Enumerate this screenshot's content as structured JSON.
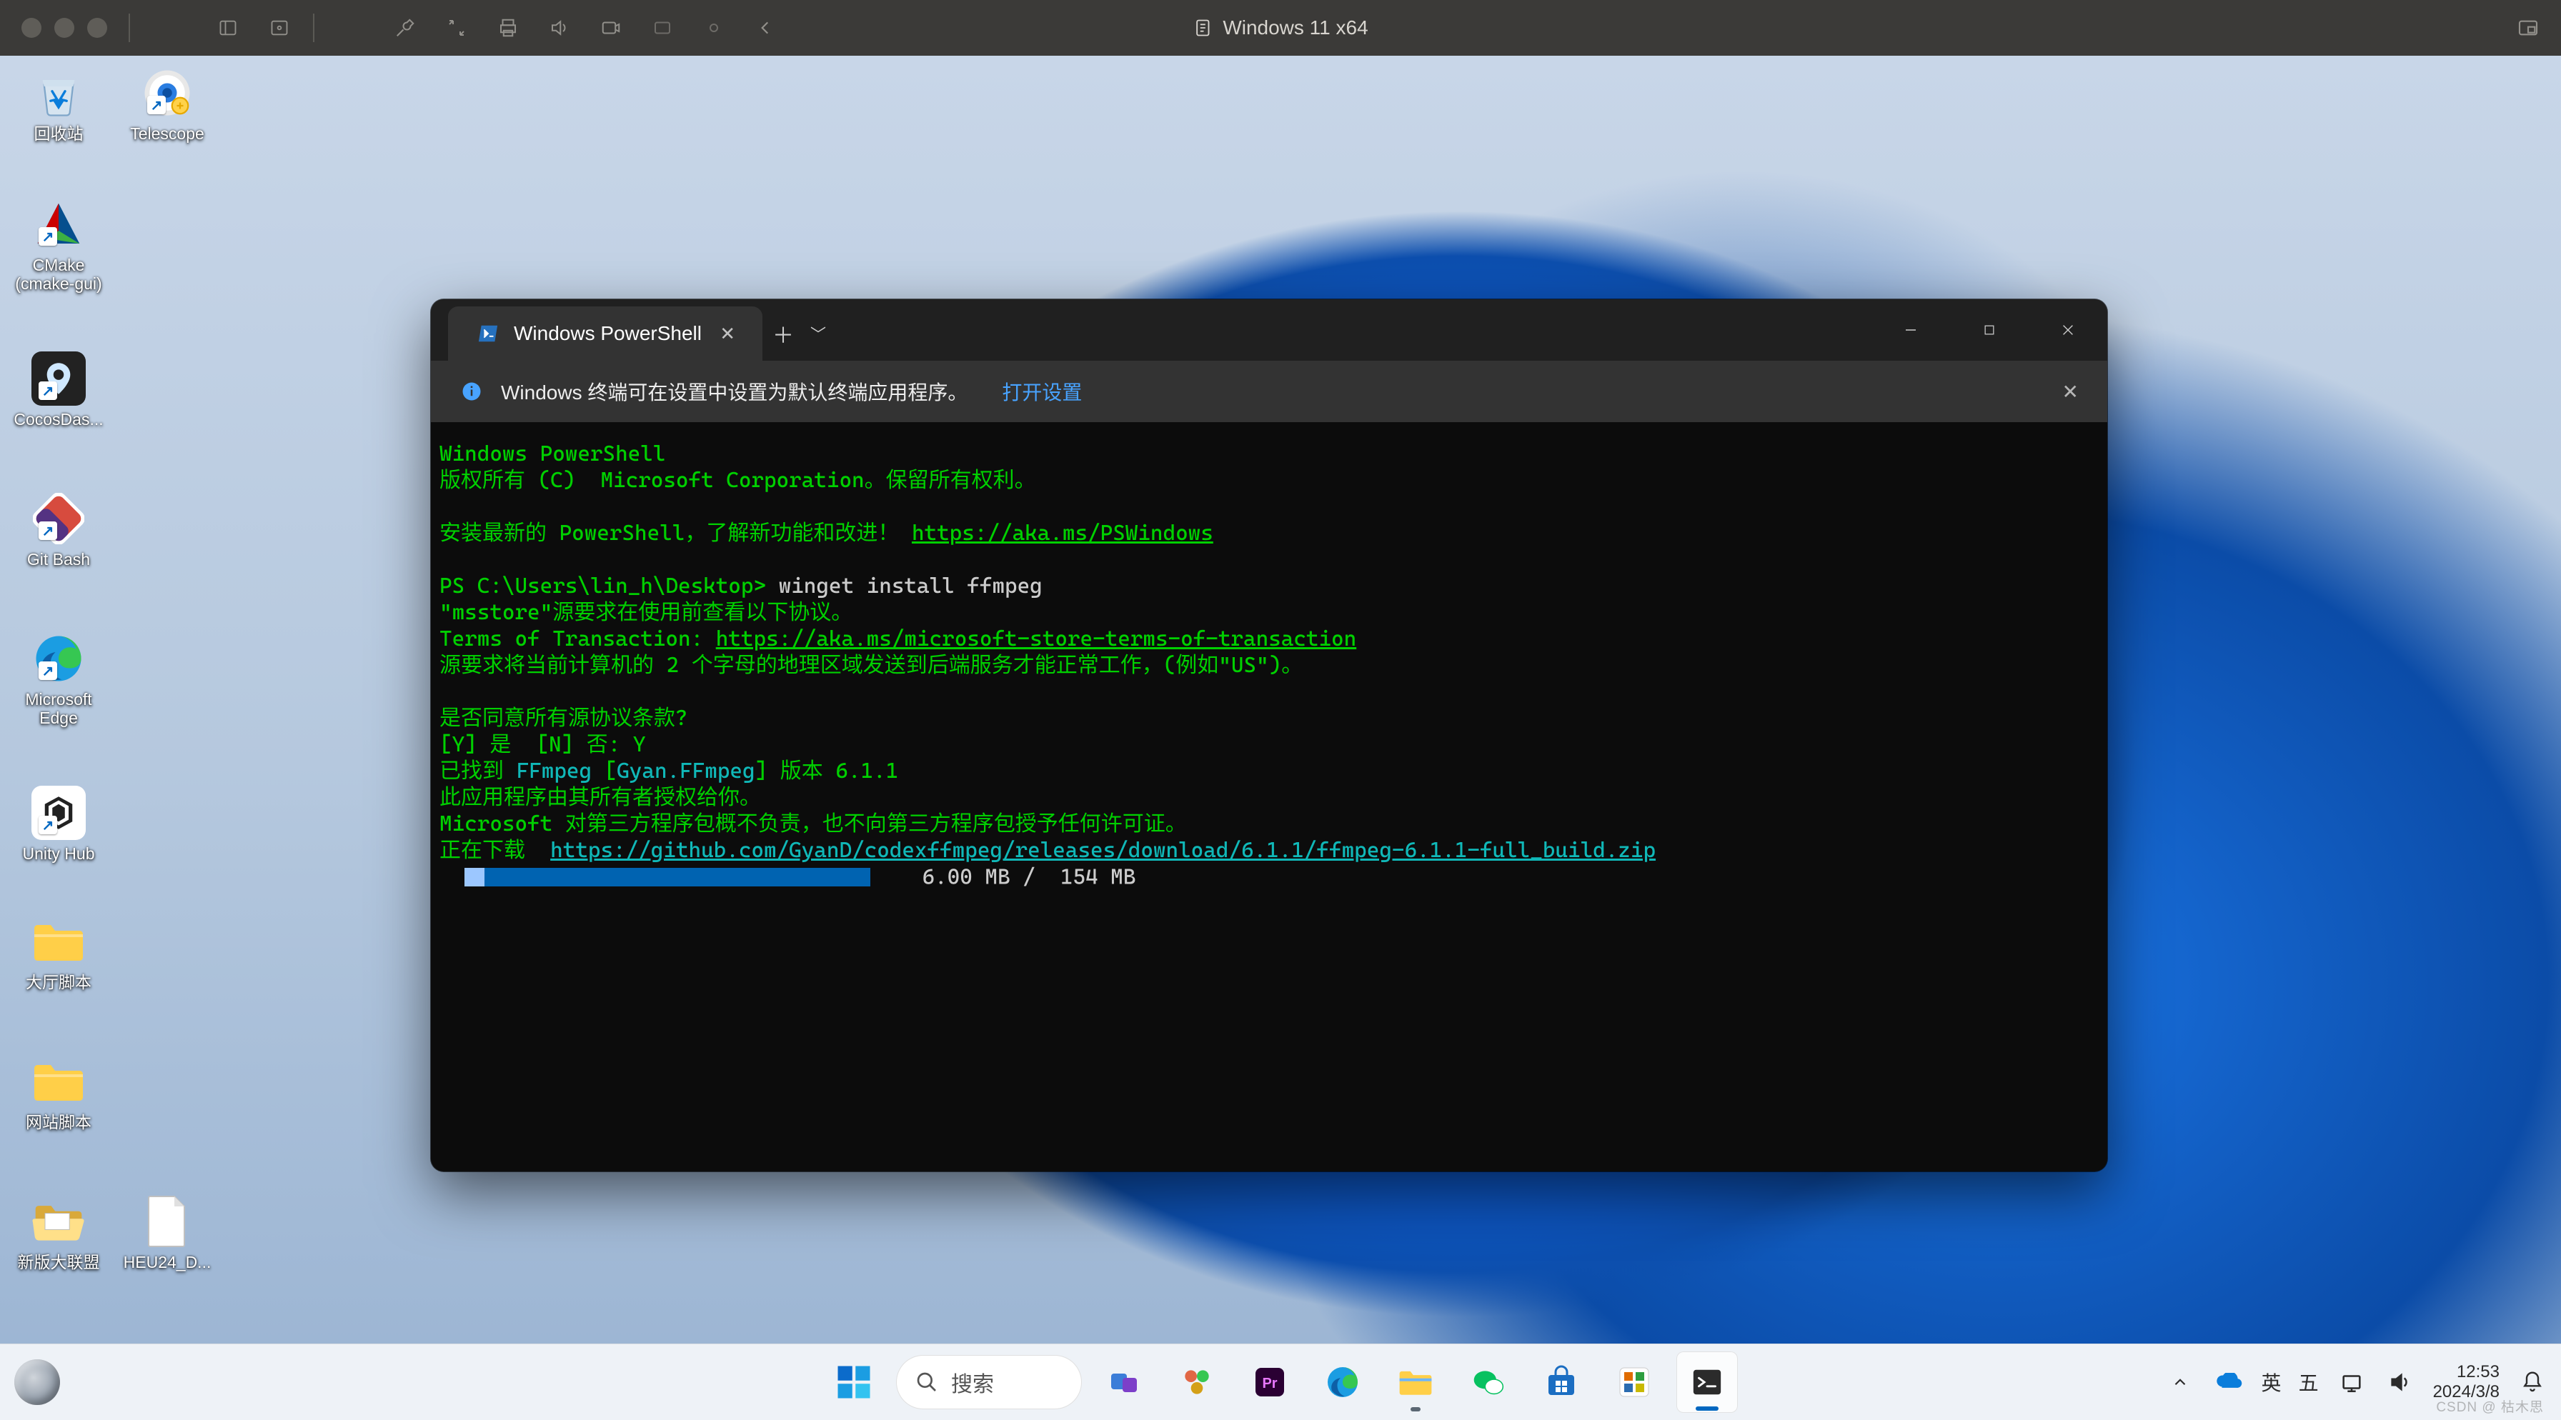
{
  "host": {
    "vm_title": "Windows 11 x64"
  },
  "desktop_icons": [
    {
      "id": "recycle",
      "label": "回收站"
    },
    {
      "id": "telescope",
      "label": "Telescope"
    },
    {
      "id": "cmake",
      "label": "CMake (cmake-gui)"
    },
    {
      "id": "cocos",
      "label": "CocosDas..."
    },
    {
      "id": "gitbash",
      "label": "Git Bash"
    },
    {
      "id": "edge",
      "label": "Microsoft Edge"
    },
    {
      "id": "unity",
      "label": "Unity Hub"
    },
    {
      "id": "folder1",
      "label": "大厅脚本"
    },
    {
      "id": "folder2",
      "label": "网站脚本"
    },
    {
      "id": "folder3",
      "label": "新版大联盟"
    },
    {
      "id": "heu",
      "label": "HEU24_D..."
    }
  ],
  "terminal": {
    "tab_title": "Windows PowerShell",
    "info_text": "Windows 终端可在设置中设置为默认终端应用程序。",
    "info_link": "打开设置",
    "header1": "Windows PowerShell",
    "header2": "版权所有 (C)  Microsoft Corporation。保留所有权利。",
    "install_hint": "安装最新的 PowerShell，了解新功能和改进！",
    "install_url": "https://aka.ms/PSWindows",
    "prompt_prefix": "PS C:\\Users\\lin_h\\Desktop>",
    "command": "winget install ffmpeg",
    "msstore_line": "\"msstore\"源要求在使用前查看以下协议。",
    "terms_label": "Terms of Transaction:",
    "terms_url": "https://aka.ms/microsoft-store-terms-of-transaction",
    "region_line": "源要求将当前计算机的 2 个字母的地理区域发送到后端服务才能正常工作，(例如\"US\")。",
    "agree_q": "是否同意所有源协议条款?",
    "agree_opts": "[Y] 是  [N] 否: Y",
    "found_pre": "已找到 ",
    "found_pkg": "FFmpeg ",
    "found_bracket_open": "[",
    "found_pkg_id": "Gyan.FFmpeg",
    "found_bracket_close": "]",
    "found_post": " 版本 6.1.1",
    "owner_line": "此应用程序由其所有者授权给你。",
    "ms_line": "Microsoft 对第三方程序包概不负责，也不向第三方程序包授予任何许可证。",
    "dl_pre": "正在下载 ",
    "dl_url": "https://github.com/GyanD/codexffmpeg/releases/download/6.1.1/ffmpeg-6.1.1-full_build.zip",
    "progress_text": "  6.00 MB /  154 MB",
    "progress_pct": 3.9
  },
  "taskbar": {
    "search_placeholder": "搜索",
    "ime_lang": "英",
    "ime_method": "五",
    "time": "12:53",
    "date": "2024/3/8"
  },
  "watermark": "CSDN @ 枯木思"
}
